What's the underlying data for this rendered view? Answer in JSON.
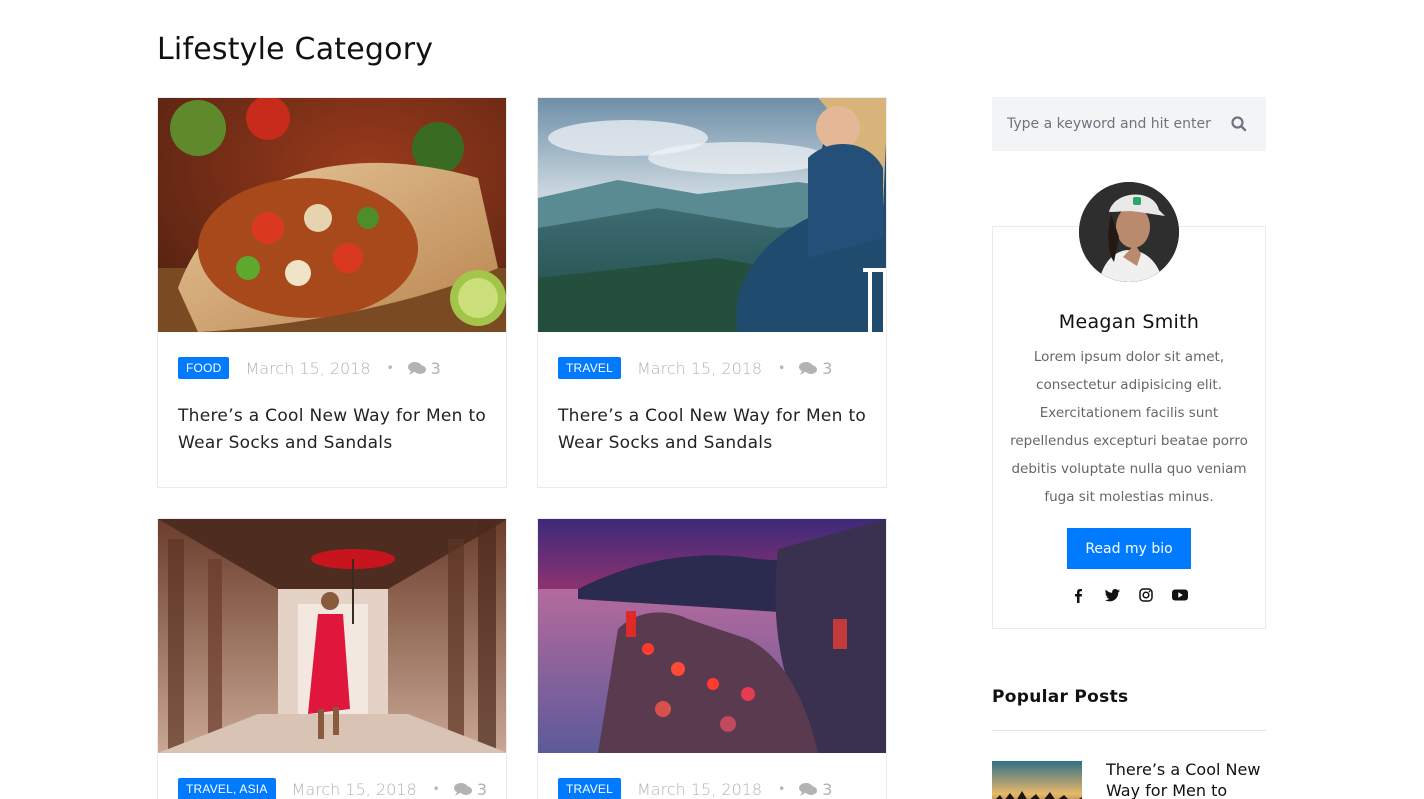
{
  "page": {
    "title": "Lifestyle Category"
  },
  "posts": [
    {
      "category": "FOOD",
      "date": "March 15, 2018",
      "comments": "3",
      "title": "There’s a Cool New Way for Men to Wear Socks and Sandals",
      "image": "burrito-photo"
    },
    {
      "category": "TRAVEL",
      "date": "March 15, 2018",
      "comments": "3",
      "title": "There’s a Cool New Way for Men to Wear Socks and Sandals",
      "image": "woman-mountain-photo"
    },
    {
      "category": "TRAVEL, ASIA",
      "date": "March 15, 2018",
      "comments": "3",
      "title": "",
      "image": "monk-umbrella-photo"
    },
    {
      "category": "TRAVEL",
      "date": "March 15, 2018",
      "comments": "3",
      "title": "",
      "image": "coastal-town-sunset-photo"
    }
  ],
  "sidebar": {
    "search": {
      "placeholder": "Type a keyword and hit enter",
      "icon": "search-icon"
    },
    "bio": {
      "name": "Meagan Smith",
      "text": "Lorem ipsum dolor sit amet, consectetur adipisicing elit. Exercitationem facilis sunt repellendus excepturi beatae porro debitis voluptate nulla quo veniam fuga sit molestias minus.",
      "button": "Read my bio",
      "socials": [
        "facebook-icon",
        "twitter-icon",
        "instagram-icon",
        "youtube-icon"
      ]
    },
    "popular": {
      "heading": "Popular Posts",
      "items": [
        {
          "title": "There’s a Cool New Way for Men to"
        }
      ]
    }
  },
  "colors": {
    "accent": "#007bff",
    "muted": "#b3b3b3",
    "border": "#e9ecef"
  }
}
